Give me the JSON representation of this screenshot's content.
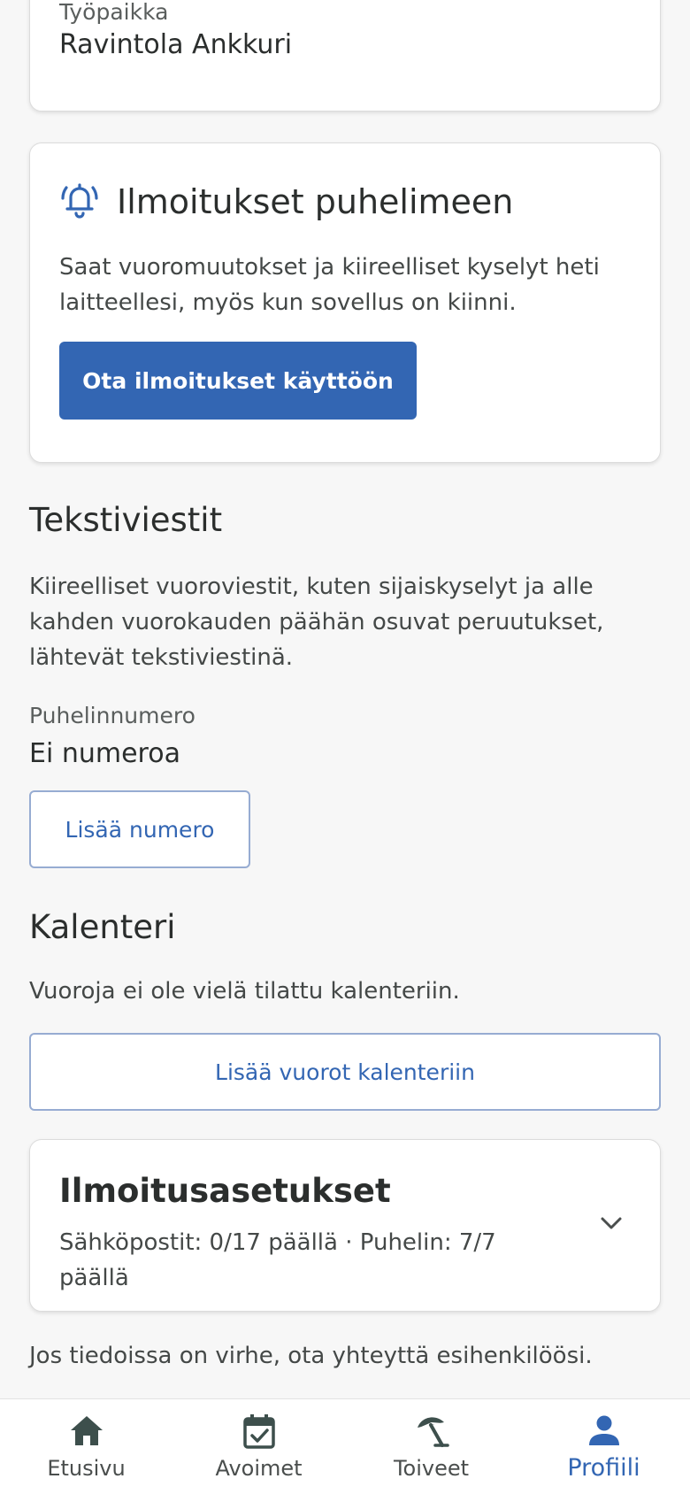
{
  "workplace": {
    "label": "Työpaikka",
    "value": "Ravintola Ankkuri"
  },
  "push_notifications": {
    "icon": "bell-icon",
    "title": "Ilmoitukset puhelimeen",
    "description": "Saat vuoromuutokset ja kiireelliset kyselyt heti laitteellesi, myös kun sovellus on kiinni.",
    "enable_button": "Ota ilmoitukset käyttöön"
  },
  "sms": {
    "title": "Tekstiviestit",
    "description": "Kiireelliset vuoroviestit, kuten sijaiskyselyt ja alle kahden vuorokauden päähän osuvat peruutukset, lähtevät tekstiviestinä.",
    "phone_label": "Puhelinnumero",
    "phone_value": "Ei numeroa",
    "add_number_button": "Lisää numero"
  },
  "calendar": {
    "title": "Kalenteri",
    "status": "Vuoroja ei ole vielä tilattu kalenteriin.",
    "add_button": "Lisää vuorot kalenteriin"
  },
  "notification_settings": {
    "title": "Ilmoitusasetukset",
    "summary": "Sähköpostit: 0/17 päällä · Puhelin: 7/7 päällä",
    "icon": "chevron-down-icon"
  },
  "footer_note": "Jos tiedoissa on virhe, ota yhteyttä esihenkilöösi.",
  "bottom_nav": {
    "items": [
      {
        "label": "Etusivu",
        "icon": "home-icon"
      },
      {
        "label": "Avoimet",
        "icon": "calendar-check-icon"
      },
      {
        "label": "Toiveet",
        "icon": "beach-umbrella-icon"
      },
      {
        "label": "Profiili",
        "icon": "person-icon"
      }
    ],
    "active_color": "#3366b3",
    "icon_color": "#3d4f4c"
  },
  "colors": {
    "primary": "#3366b3",
    "background": "#f7f7f7",
    "text": "#2b2e2d"
  }
}
